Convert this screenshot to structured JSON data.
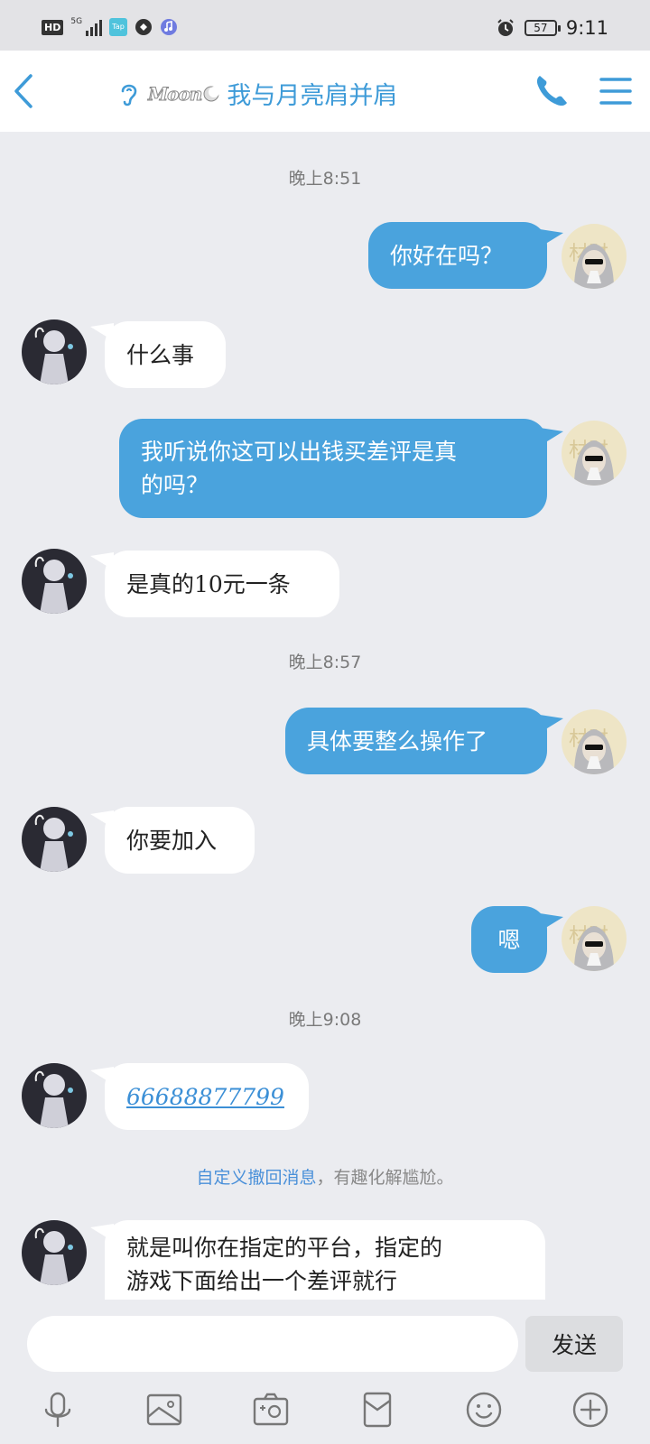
{
  "status_bar": {
    "hd": "HD",
    "network": "5G",
    "app_icon_label": "Tap",
    "battery": "57",
    "time": "9:11"
  },
  "header": {
    "logo_text": "Moon",
    "title": "我与月亮肩并肩"
  },
  "conversation": {
    "timestamps": [
      "晚上8:51",
      "晚上8:57",
      "晚上9:08"
    ],
    "messages": [
      "你好在吗？",
      "什么事",
      "我听说你这可以出钱买差评是真的吗？",
      "是真的10元一条",
      "具体要整么操作了",
      "你要加入",
      "嗯",
      "66688877799",
      "就是叫你在指定的平台，指定的游戏下面给出一个差评就行"
    ],
    "line_breaks": {
      "msg2_line1": "我听说你这可以出钱买差评是真",
      "msg2_line2": "的吗？",
      "msg8_line1": "就是叫你在指定的平台，指定的",
      "msg8_line2": "游戏下面给出一个差评就行"
    }
  },
  "notice": {
    "highlight": "自定义撤回消息",
    "rest": "，有趣化解尴尬。"
  },
  "input": {
    "placeholder": "",
    "send_label": "发送"
  },
  "colors": {
    "accent": "#3e9bd8",
    "bubble_out": "#4aa3dd",
    "bubble_in": "#ffffff",
    "background": "#ebecf0"
  }
}
